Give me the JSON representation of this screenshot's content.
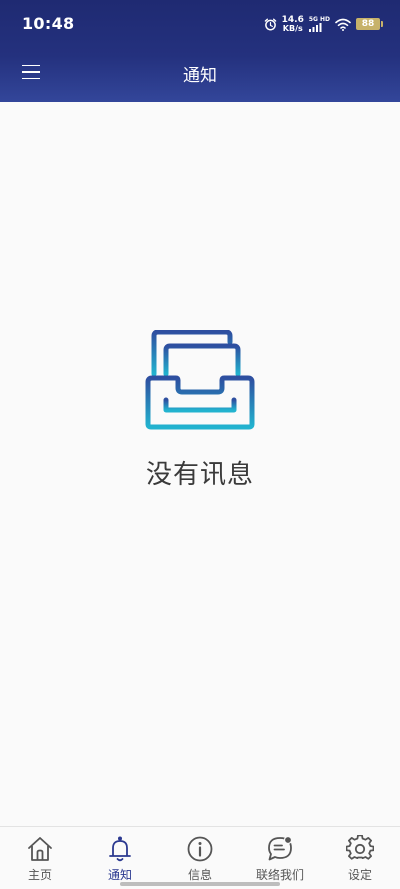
{
  "status_bar": {
    "time": "10:48",
    "net_speed_value": "14.6",
    "net_speed_unit": "KB/s",
    "net_type_top": "5G",
    "net_type_bottom": "HD",
    "battery": "88"
  },
  "header": {
    "title": "通知",
    "menu_icon": "hamburger-menu-icon"
  },
  "empty_state": {
    "icon": "empty-inbox-icon",
    "message": "没有讯息"
  },
  "tabs": [
    {
      "label": "主页",
      "icon": "home-icon",
      "active": false
    },
    {
      "label": "通知",
      "icon": "bell-icon",
      "active": true
    },
    {
      "label": "信息",
      "icon": "info-icon",
      "active": false
    },
    {
      "label": "联络我们",
      "icon": "chat-icon",
      "active": false
    },
    {
      "label": "设定",
      "icon": "gear-icon",
      "active": false
    }
  ],
  "colors": {
    "header_dark": "#1f2a72",
    "header_light": "#33469a",
    "accent": "#2b3990",
    "tab_inactive": "#555555",
    "illustration_top": "#2e4fa0",
    "illustration_bottom": "#22b3cf"
  }
}
